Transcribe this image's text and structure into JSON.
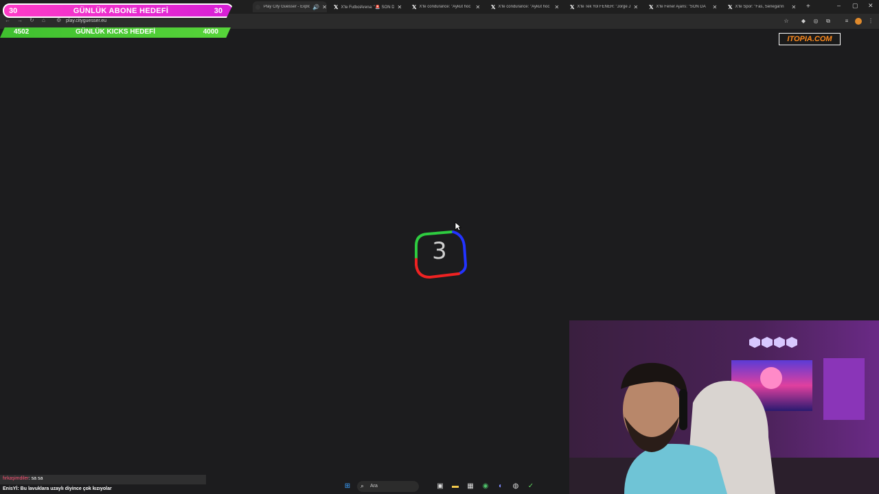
{
  "overlay": {
    "subscriber_goal": {
      "current": "30",
      "title": "GÜNLÜK ABONE HEDEFİ",
      "target": "30"
    },
    "kicks_goal": {
      "current": "4502",
      "title": "GÜNLÜK KICKS HEDEFİ",
      "target": "4000"
    },
    "brand_logo_text": "ITOPIA.COM"
  },
  "browser": {
    "tabs": [
      {
        "title": "Play City Guesser - Explo",
        "active": true
      },
      {
        "title": "X'te FutbolArena: \"🚨 SON D",
        "active": false
      },
      {
        "title": "X'te condurance: \"Aykut hoc",
        "active": false
      },
      {
        "title": "X'te condurance: \"Aykut hoc",
        "active": false
      },
      {
        "title": "X'te Tek Yol FENER: \"Jorge Je",
        "active": false
      },
      {
        "title": "X'te Fener Ajans: \"SON DA",
        "active": false
      },
      {
        "title": "X'te Spor: \"Fas, Senegal'in",
        "active": false
      }
    ],
    "url": "play.cityguesser.eu"
  },
  "countdown": {
    "value": "3"
  },
  "chat": [
    {
      "user": "fırkaşimdiler",
      "message": ": sa sa"
    },
    {
      "user": "EnisYİ",
      "message": ": Bu lavuklara uzaylı diyince çok kızıyolar"
    }
  ],
  "taskbar": {
    "search_placeholder": "Ara"
  }
}
